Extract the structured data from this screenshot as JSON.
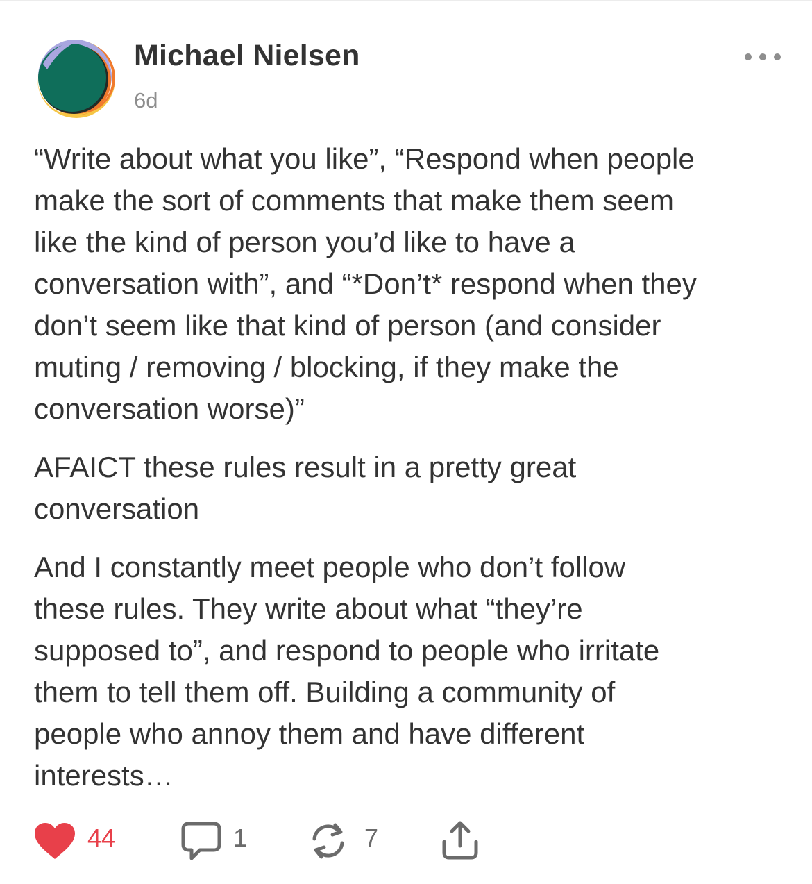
{
  "post": {
    "author": "Michael Nielsen",
    "time": "6d",
    "paragraphs": [
      "“Write about what you like”, “Respond when people\nmake the sort of comments that make them seem\nlike the kind of person you’d like to have a\nconversation with”, and “*Don’t* respond when they\ndon’t seem like that kind of person (and consider\nmuting / removing / blocking, if they make the\nconversation worse)”",
      "AFAICT these rules result in a pretty great\nconversation",
      "And I constantly meet people who don’t follow\nthese rules. They write about what “they’re\nsupposed to”, and respond to people who irritate\nthem to tell them off.  Building a community of\npeople who annoy them and have different\ninterests…"
    ]
  },
  "actions": {
    "likes": "44",
    "comments": "1",
    "restacks": "7"
  },
  "icons": {
    "more": "more-dots-icon",
    "like": "heart-icon",
    "comment": "comment-bubble-icon",
    "restack": "restack-arrows-icon",
    "share": "share-icon"
  },
  "colors": {
    "text": "#333333",
    "muted": "#8e8e8e",
    "like": "#e8404a",
    "action_icon": "#6b6b6b",
    "avatar_green": "#0f6e5a",
    "avatar_orange": "#f07a2d",
    "avatar_yellow": "#f6c544",
    "avatar_lavender": "#a9a6e0"
  }
}
